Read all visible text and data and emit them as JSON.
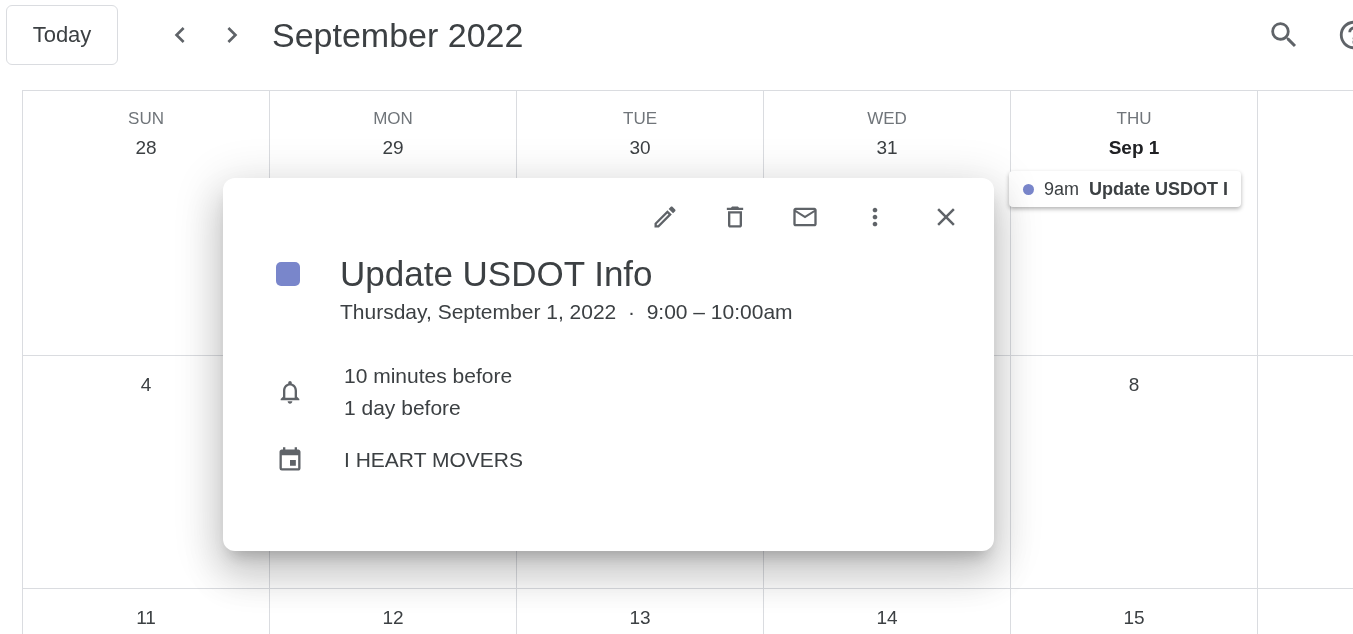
{
  "toolbar": {
    "today_button": "Today",
    "title": "September 2022"
  },
  "weeks": [
    {
      "cells": [
        {
          "weekday": "SUN",
          "date": "28",
          "bold": false
        },
        {
          "weekday": "MON",
          "date": "29",
          "bold": false
        },
        {
          "weekday": "TUE",
          "date": "30",
          "bold": false
        },
        {
          "weekday": "WED",
          "date": "31",
          "bold": false
        },
        {
          "weekday": "THU",
          "date": "Sep 1",
          "bold": true,
          "events": [
            {
              "time": "9am",
              "title": "Update USDOT I",
              "color": "#7986cb"
            }
          ]
        },
        {}
      ]
    },
    {
      "cells": [
        {
          "date": "4",
          "bold": false
        },
        {},
        {},
        {},
        {
          "date": "8",
          "bold": false
        },
        {}
      ]
    },
    {
      "cells": [
        {
          "date": "11",
          "bold": false
        },
        {
          "date": "12",
          "bold": false
        },
        {
          "date": "13",
          "bold": false
        },
        {
          "date": "14",
          "bold": false
        },
        {
          "date": "15",
          "bold": false
        },
        {}
      ]
    }
  ],
  "popup": {
    "color": "#7986cb",
    "title": "Update USDOT Info",
    "date": "Thursday, September 1, 2022",
    "separator": "·",
    "time": "9:00 – 10:00am",
    "reminders": [
      "10 minutes before",
      "1 day before"
    ],
    "calendar": "I HEART MOVERS"
  }
}
